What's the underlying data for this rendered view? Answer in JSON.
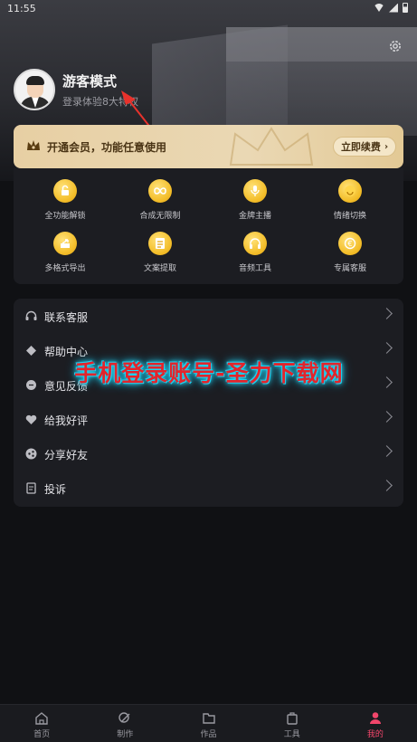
{
  "status_bar": {
    "time": "11:55"
  },
  "profile": {
    "name": "游客模式",
    "subtitle": "登录体验8大特权"
  },
  "vip_banner": {
    "text": "开通会员，功能任意使用",
    "button": "立即续费"
  },
  "features": [
    {
      "label": "全功能解锁",
      "icon": "lock-icon"
    },
    {
      "label": "合成无限制",
      "icon": "infinity-icon"
    },
    {
      "label": "金牌主播",
      "icon": "microphone-icon"
    },
    {
      "label": "情绪切换",
      "icon": "smile-icon"
    },
    {
      "label": "多格式导出",
      "icon": "export-icon"
    },
    {
      "label": "文案提取",
      "icon": "document-icon"
    },
    {
      "label": "音频工具",
      "icon": "headphones-icon"
    },
    {
      "label": "专属客服",
      "icon": "service-icon"
    }
  ],
  "menu": [
    {
      "label": "联系客服",
      "icon": "headset-icon"
    },
    {
      "label": "帮助中心",
      "icon": "help-icon"
    },
    {
      "label": "意见反馈",
      "icon": "feedback-icon"
    },
    {
      "label": "给我好评",
      "icon": "heart-icon"
    },
    {
      "label": "分享好友",
      "icon": "share-icon"
    },
    {
      "label": "投诉",
      "icon": "complaint-icon"
    }
  ],
  "watermark": "手机登录账号-圣力下载网",
  "tabs": [
    {
      "label": "首页",
      "icon": "home-icon"
    },
    {
      "label": "制作",
      "icon": "create-icon"
    },
    {
      "label": "作品",
      "icon": "folder-icon"
    },
    {
      "label": "工具",
      "icon": "toolbox-icon"
    },
    {
      "label": "我的",
      "icon": "user-icon",
      "active": true
    }
  ],
  "colors": {
    "accent": "#f2466b",
    "vip_gold": "#e7cfa3",
    "feature_gold": "#f4c02e",
    "watermark_red": "#e3242b",
    "watermark_glow": "#21d6f3"
  }
}
